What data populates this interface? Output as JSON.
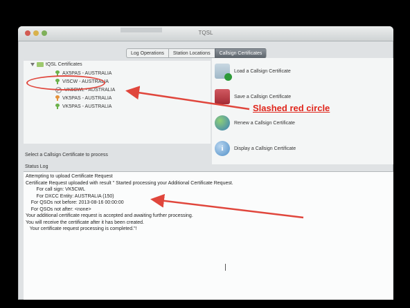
{
  "window": {
    "title": "TQSL"
  },
  "tabs": [
    {
      "label": "Log Operations"
    },
    {
      "label": "Station Locations"
    },
    {
      "label": "Callsign Certificates"
    }
  ],
  "tree": {
    "root_label": "tQSL Certificates",
    "items": [
      {
        "label": "AX5PAS - AUSTRALIA",
        "icon": "key-green"
      },
      {
        "label": "VI5CW - AUSTRALIA",
        "icon": "key-green"
      },
      {
        "label": "VK5CWL - AUSTRALIA",
        "icon": "slashed-circle"
      },
      {
        "label": "VK5PAS - AUSTRALIA",
        "icon": "key-orange"
      },
      {
        "label": "VK5PAS - AUSTRALIA",
        "icon": "key-green"
      }
    ]
  },
  "select_hint": "Select a Callsign Certificate to process",
  "actions": [
    {
      "label": "Load a Callsign Certificate",
      "icon": "load-certificate-icon"
    },
    {
      "label": "Save a Callsign Certificate",
      "icon": "save-certificate-icon"
    },
    {
      "label": "Renew a Callsign Certificate",
      "icon": "renew-certificate-icon"
    },
    {
      "label": "Display a Callsign Certificate",
      "icon": "display-certificate-icon"
    }
  ],
  "status": {
    "header": "Status Log",
    "lines": [
      "Attempting to upload Certificate Request",
      "Certificate Request uploaded with result \" Started processing your Additional Certificate Request.",
      "        For call sign: VK5CWL",
      "        For DXCC Entity: AUSTRALIA (150)",
      "    For QSOs not before: 2013-08-16 00:00:00",
      "    For QSOs not after: <none>",
      "Your additional certificate request is accepted and awaiting further processing.",
      "You will receive the certificate after it has been created.",
      "   Your certificate request processing is completed.\"!"
    ]
  },
  "annotation": {
    "label": "Slashed red circle",
    "color": "#e0251b"
  }
}
